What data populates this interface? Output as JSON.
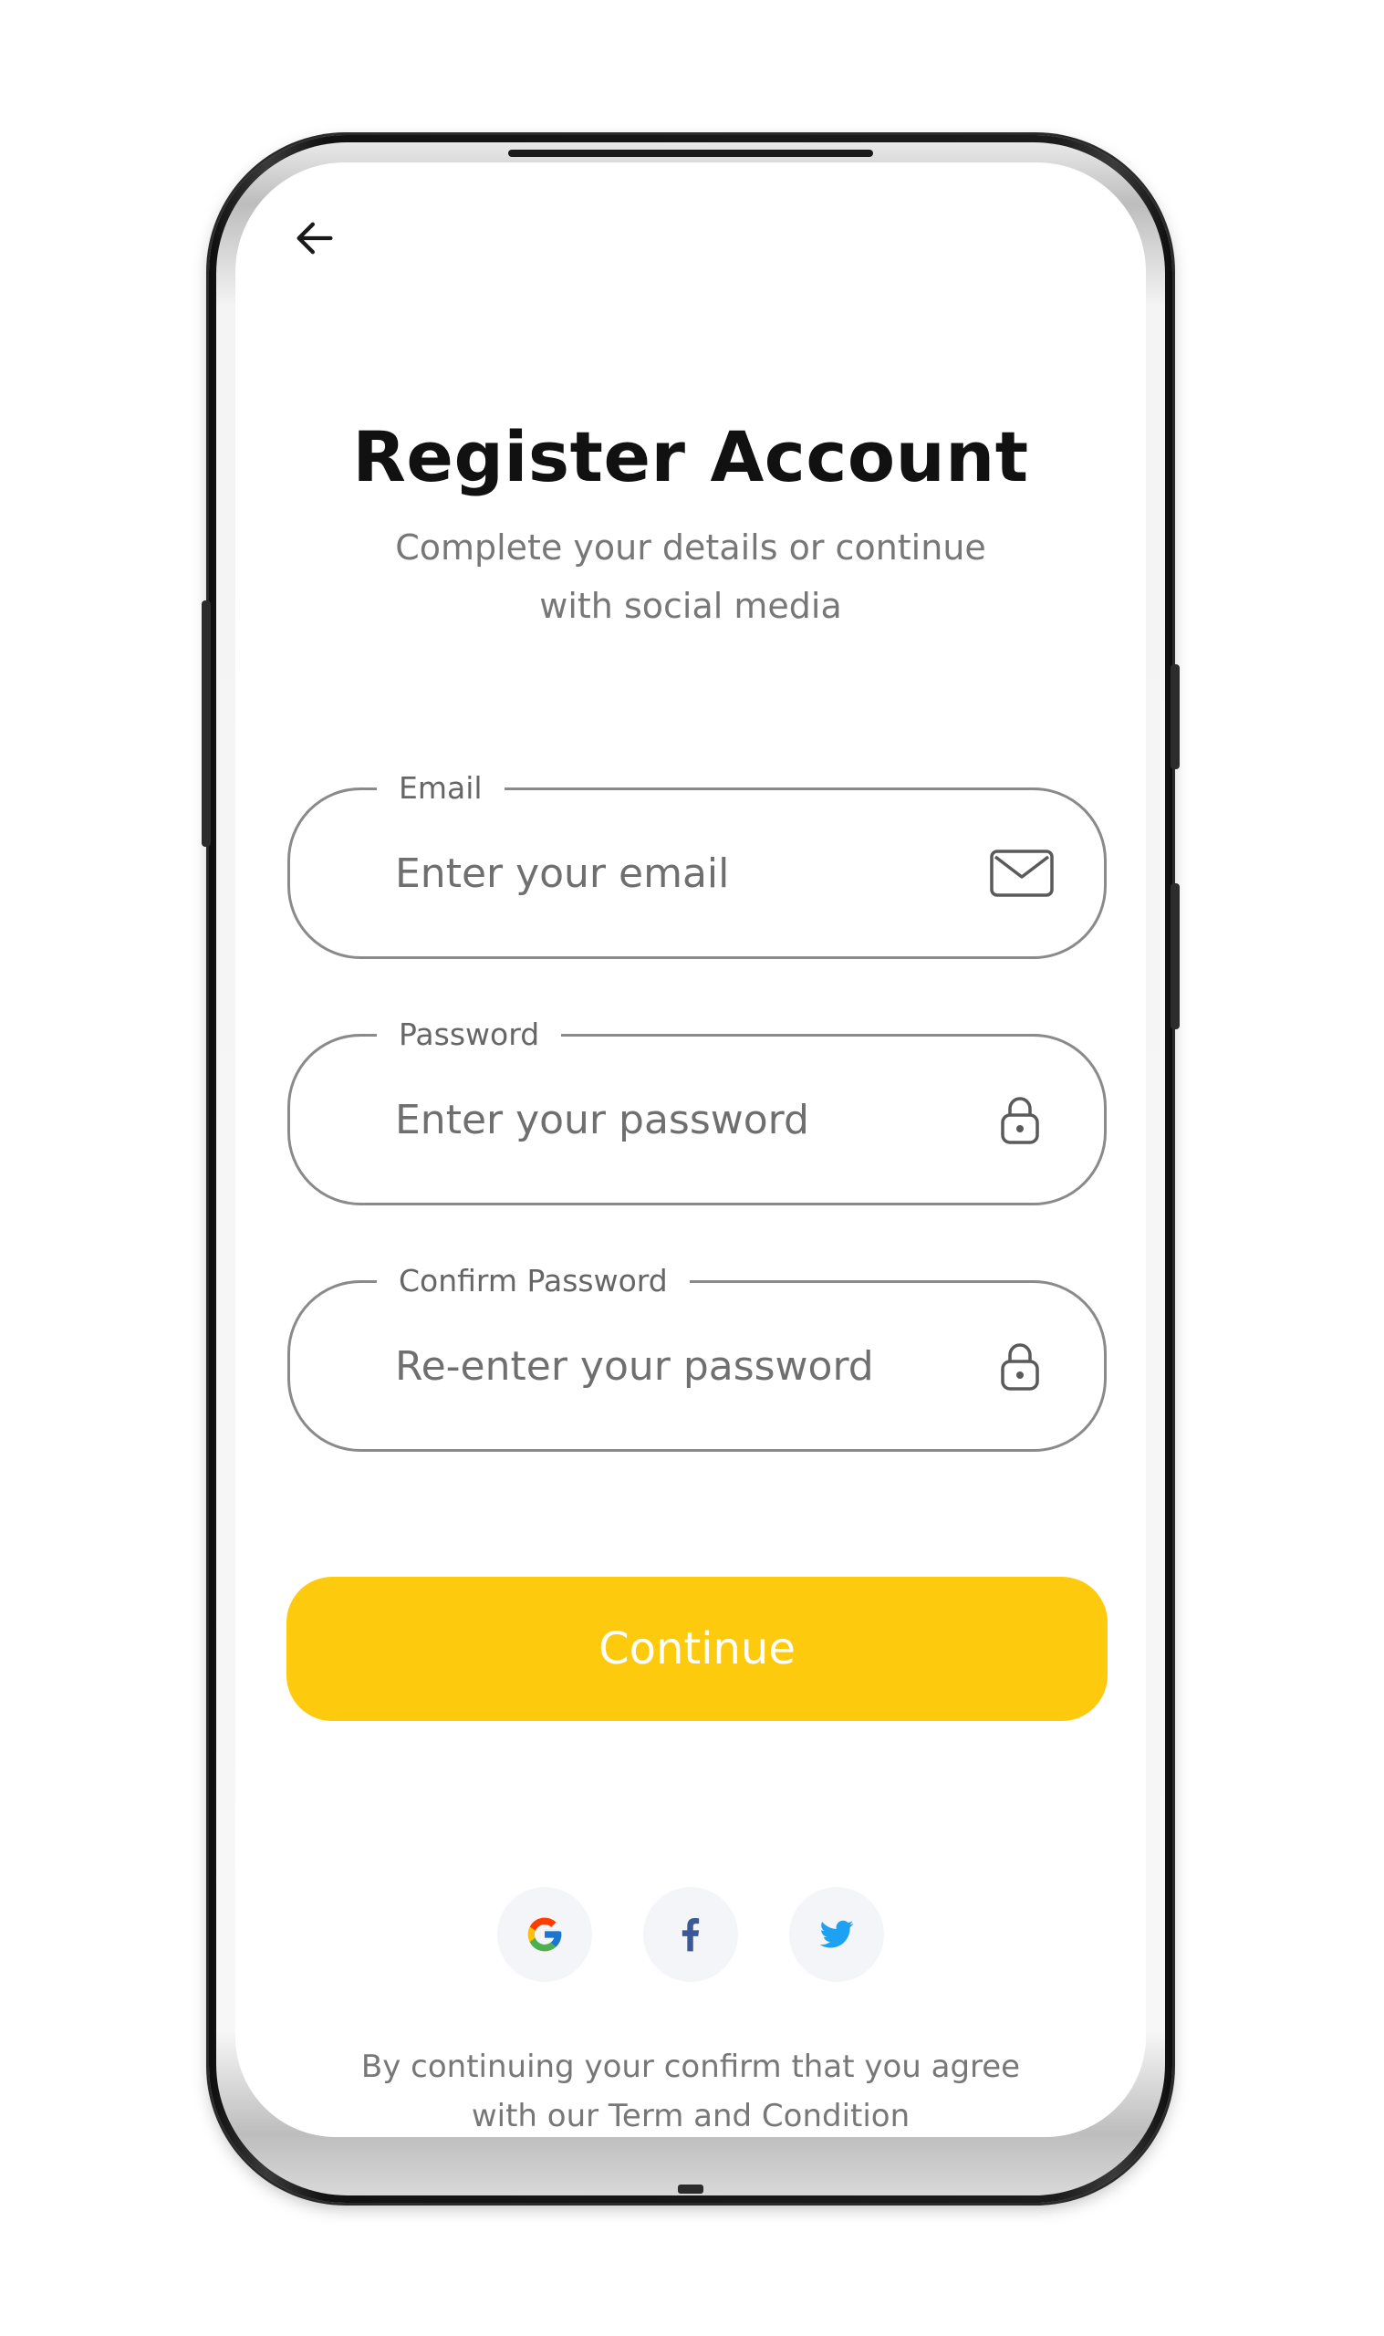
{
  "header": {
    "back_icon": "arrow-left-icon"
  },
  "title": "Register Account",
  "subtitle": {
    "line1": "Complete your details or continue",
    "line2": "with social media"
  },
  "form": {
    "email": {
      "label": "Email",
      "placeholder": "Enter your email",
      "value": "",
      "icon": "mail-icon"
    },
    "password": {
      "label": "Password",
      "placeholder": "Enter your password",
      "value": "",
      "icon": "lock-icon"
    },
    "confirm_password": {
      "label": "Confirm Password",
      "placeholder": "Re-enter your password",
      "value": "",
      "icon": "lock-icon"
    }
  },
  "continue_label": "Continue",
  "social": [
    {
      "name": "google",
      "icon": "google-icon"
    },
    {
      "name": "facebook",
      "icon": "facebook-icon"
    },
    {
      "name": "twitter",
      "icon": "twitter-icon"
    }
  ],
  "footer": {
    "line1": "By continuing your confirm that you agree",
    "line2": "with our Term and Condition"
  },
  "colors": {
    "accent": "#FDCA0D",
    "title": "#111111",
    "muted_text": "#777777",
    "field_border": "#8A8A8A",
    "social_bg": "#F3F5F8",
    "facebook": "#3B5998",
    "twitter": "#1DA1F2"
  }
}
